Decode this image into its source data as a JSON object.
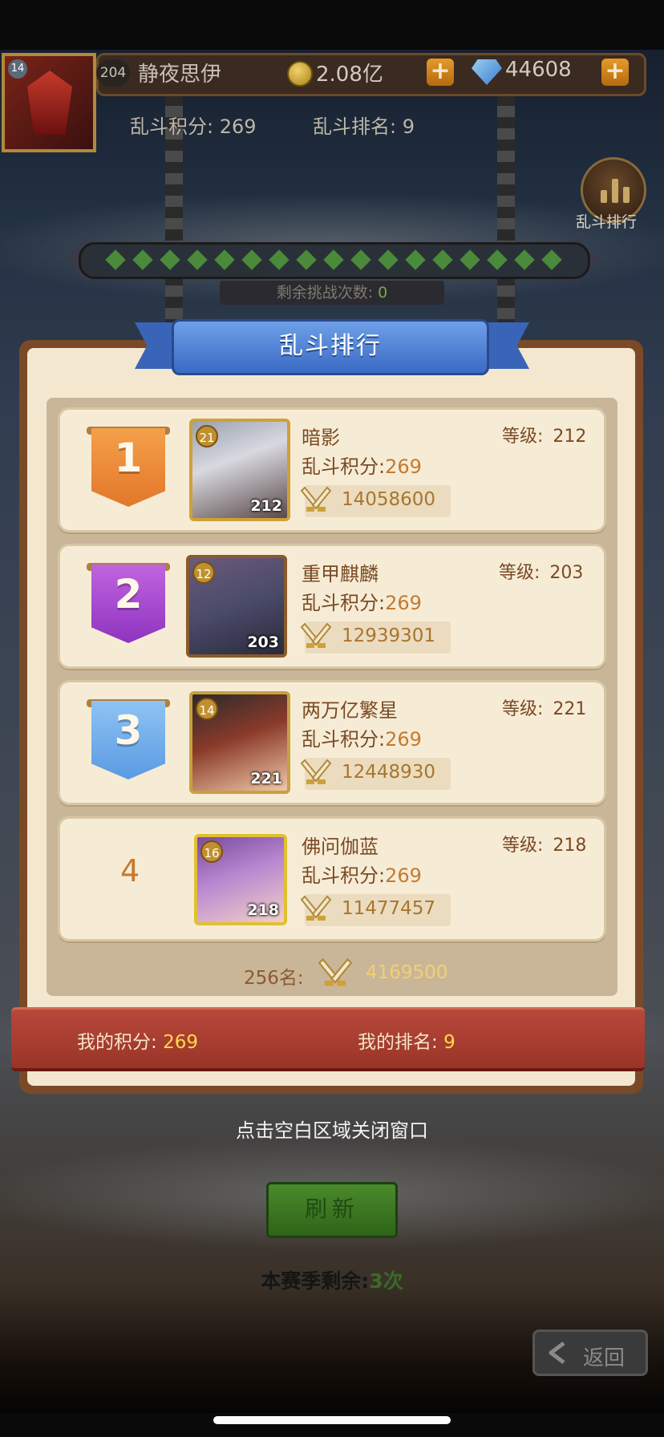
{
  "player": {
    "avatar_level": "14",
    "level": "204",
    "name": "静夜思伊",
    "gold": "2.08亿",
    "gems": "44608"
  },
  "brawl": {
    "score_label": "乱斗积分: 269",
    "rank_label": "乱斗排名: 9"
  },
  "ranking_button_label": "乱斗排行",
  "remaining_tries": {
    "label": "剩余挑战次数:",
    "value": "0"
  },
  "panel": {
    "title": "乱斗排行",
    "level_label": "等级:",
    "score_label": "乱斗积分:",
    "entries": [
      {
        "rank": "1",
        "name": "暗影",
        "level": "212",
        "avatar_level": "21",
        "hero_level": "212",
        "score": "269",
        "power": "14058600"
      },
      {
        "rank": "2",
        "name": "重甲麒麟",
        "level": "203",
        "avatar_level": "12",
        "hero_level": "203",
        "score": "269",
        "power": "12939301"
      },
      {
        "rank": "3",
        "name": "两万亿繁星",
        "level": "221",
        "avatar_level": "14",
        "hero_level": "221",
        "score": "269",
        "power": "12448930"
      },
      {
        "rank": "4",
        "name": "佛问伽蓝",
        "level": "218",
        "avatar_level": "16",
        "hero_level": "218",
        "score": "269",
        "power": "11477457"
      }
    ],
    "threshold": {
      "rank_label": "256名:",
      "power": "4169500"
    },
    "my_score_label": "我的积分:",
    "my_score": "269",
    "my_rank_label": "我的排名:",
    "my_rank": "9"
  },
  "close_hint": "点击空白区域关闭窗口",
  "refresh_label": "刷新",
  "season": {
    "label": "本赛季剩余:",
    "value": "3次"
  },
  "back_label": "返回",
  "colors": {
    "rank1": "#e8862e",
    "rank2": "#9b3cc8",
    "rank3": "#5aa0e6",
    "accent": "#c47a30",
    "ribbon": "#3a6ac4"
  }
}
